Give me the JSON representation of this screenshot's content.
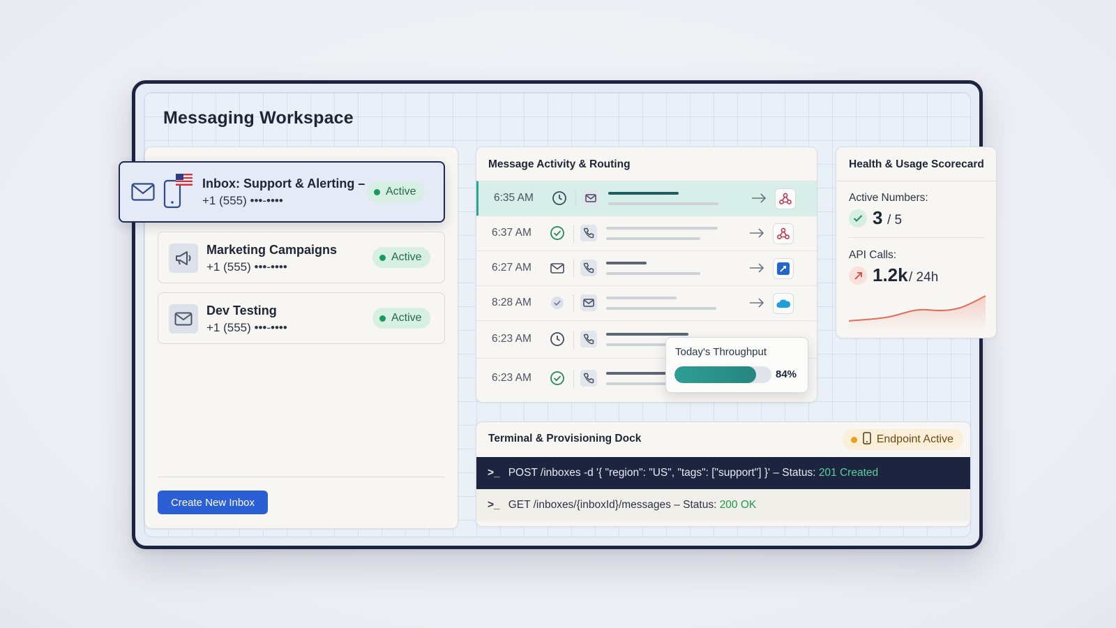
{
  "workspace": {
    "title": "Messaging Workspace"
  },
  "inboxes": [
    {
      "name": "Inbox: Support & Alerting –",
      "number": "+1 (555) •••-••••",
      "status": "Active",
      "icon": "mail-icon"
    },
    {
      "name": "Marketing Campaigns",
      "number": "+1 (555) •••-••••",
      "status": "Active",
      "icon": "megaphone-icon"
    },
    {
      "name": "Dev Testing",
      "number": "+1 (555) •••-••••",
      "status": "Active",
      "icon": "mail-icon"
    }
  ],
  "create_button": {
    "label": "Create New Inbox"
  },
  "activity": {
    "title": "Message Activity & Routing",
    "rows": [
      {
        "time": "6:35 AM",
        "status": "clock",
        "channel": "mail",
        "integration": "webhook"
      },
      {
        "time": "6:37 AM",
        "status": "check-circle",
        "channel": "phone",
        "integration": "webhook"
      },
      {
        "time": "6:27 AM",
        "status": "mail",
        "channel": "phone",
        "integration": "jira"
      },
      {
        "time": "8:28 AM",
        "status": "check-filled",
        "channel": "mail",
        "integration": "salesforce"
      },
      {
        "time": "6:23 AM",
        "status": "clock",
        "channel": "phone",
        "integration": "webhook"
      },
      {
        "time": "6:23 AM",
        "status": "check-circle",
        "channel": "phone",
        "integration": ""
      }
    ]
  },
  "throughput": {
    "label": "Today's Throughput",
    "value_text": "84%",
    "fraction": 0.84
  },
  "scorecard": {
    "title": "Health & Usage Scorecard",
    "active_numbers": {
      "label": "Active Numbers:",
      "value": "3",
      "total": "/ 5"
    },
    "api_calls": {
      "label": "API Calls:",
      "value": "1.2k",
      "period": "/ 24h"
    }
  },
  "dock": {
    "title": "Terminal & Provisioning Dock",
    "badge": "Endpoint Active",
    "lines": [
      {
        "prompt": ">_",
        "command": "POST /inboxes -d '{ \"region\": \"US\", \"tags\": [\"support\"] }' – Status: ",
        "status": "201 Created"
      },
      {
        "prompt": ">_",
        "command": "GET /inboxes/{inboxId}/messages – Status: ",
        "status": "200 OK"
      }
    ]
  },
  "colors": {
    "accent": "#2a5fd6",
    "active_green": "#1a9a5e",
    "teal": "#2aa395",
    "navy": "#1c2440",
    "warning": "#e8a21c"
  }
}
